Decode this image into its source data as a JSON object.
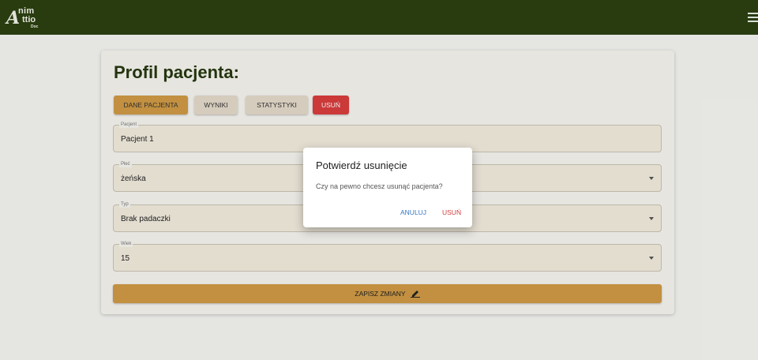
{
  "app": {
    "logo_big": "A",
    "logo_line1": "nim",
    "logo_line2": "ttio",
    "logo_line3": "Doc"
  },
  "page": {
    "title": "Profil pacjenta:"
  },
  "tabs": [
    {
      "label": "DANE PACJENTA",
      "active": true
    },
    {
      "label": "WYNIKI"
    },
    {
      "label": "STATYSTYKI"
    },
    {
      "label": "USUŃ",
      "danger": true
    }
  ],
  "fields": [
    {
      "label": "Pacjent",
      "value": "Pacjent 1"
    },
    {
      "label": "Płeć",
      "value": "żeńska"
    },
    {
      "label": "Typ",
      "value": "Brak padaczki"
    },
    {
      "label": "Wiek",
      "value": "15"
    }
  ],
  "save_label": "ZAPISZ ZMIANY",
  "dialog": {
    "title": "Potwierdź usunięcie",
    "text": "Czy na pewno chcesz usunąć pacjenta?",
    "cancel_label": "ANULUJ",
    "confirm_label": "USUŃ"
  },
  "colors": {
    "appbar": "#2b4012",
    "accent": "#cf9a45",
    "danger": "#d83d3d",
    "link": "#3576c4"
  },
  "icons": [
    "menu-icon",
    "pencil-icon",
    "chevron-down-icon"
  ]
}
